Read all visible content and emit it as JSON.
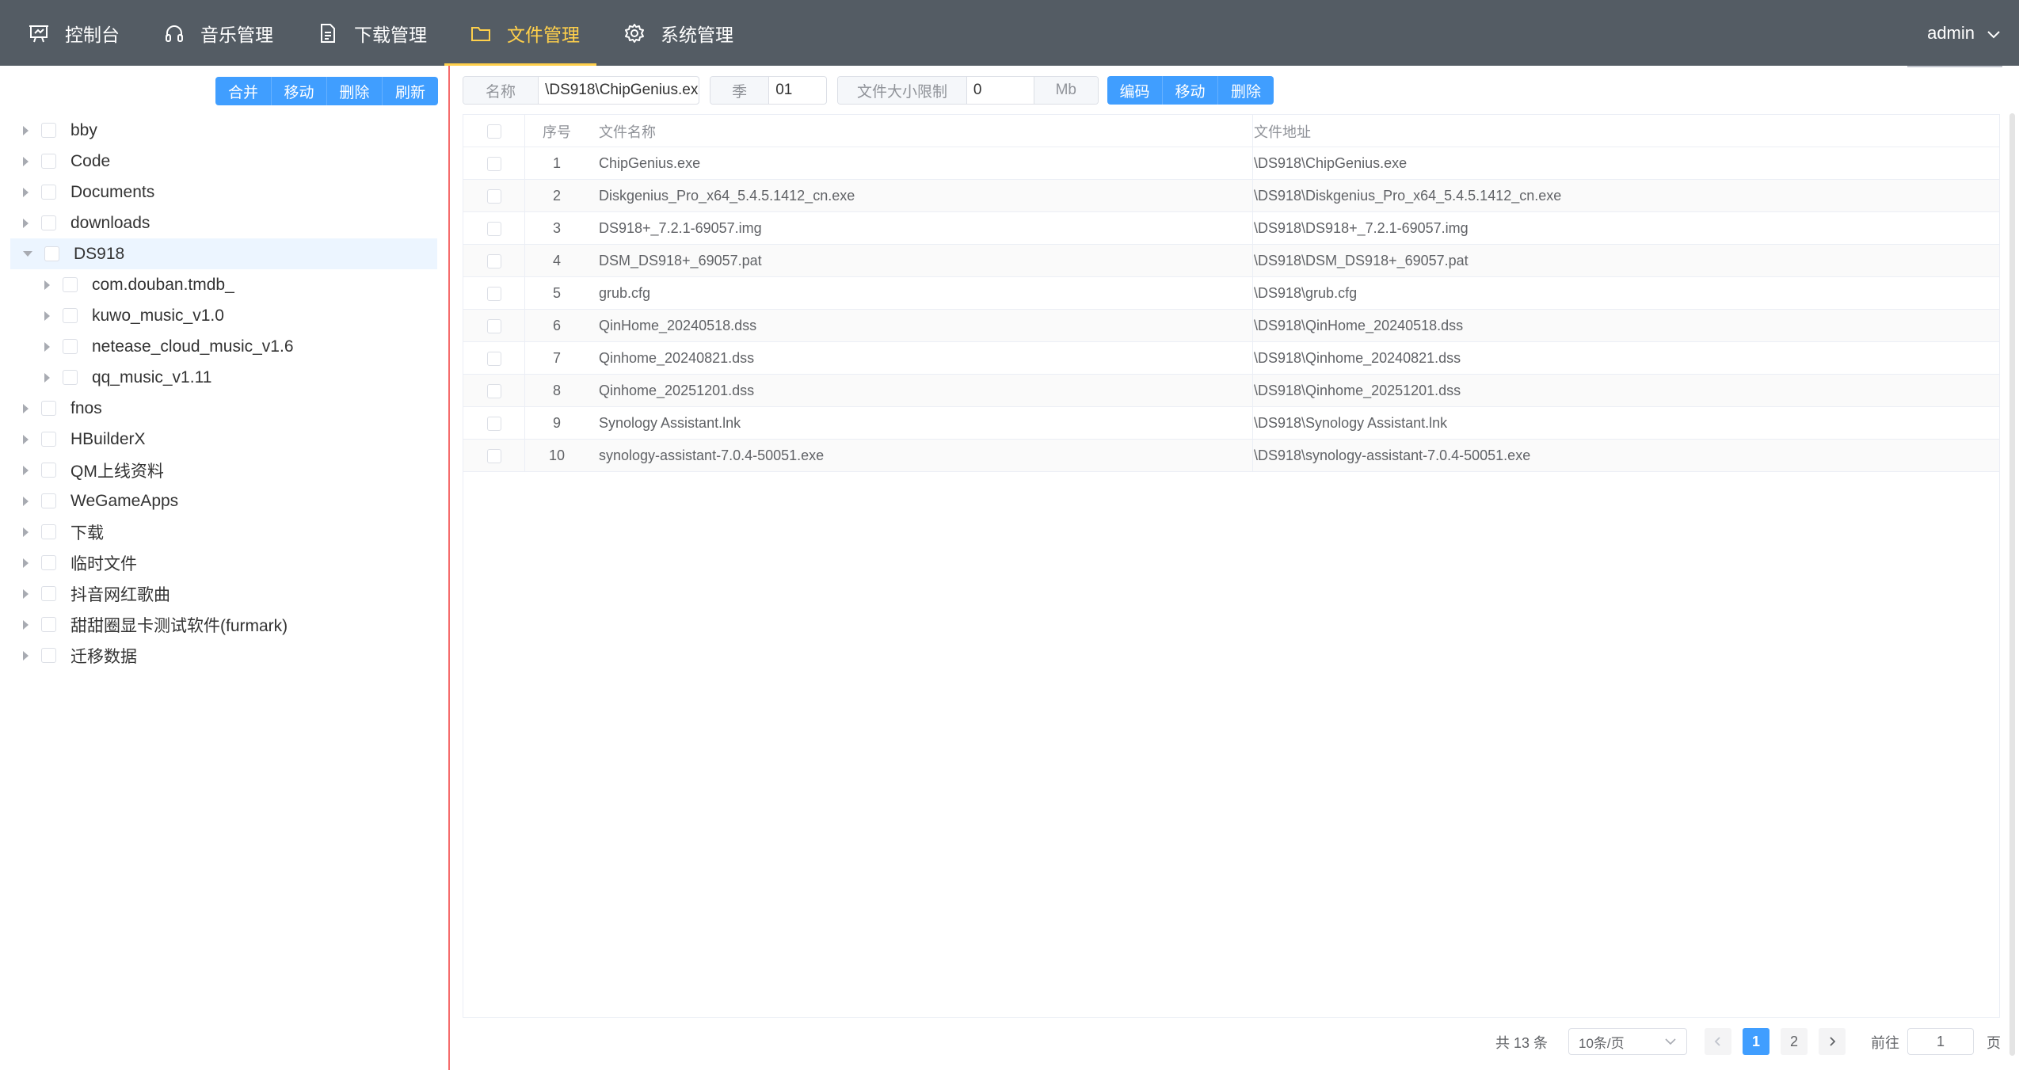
{
  "nav": {
    "items": [
      {
        "label": "控制台",
        "icon": "dashboard-icon"
      },
      {
        "label": "音乐管理",
        "icon": "headphones-icon"
      },
      {
        "label": "下载管理",
        "icon": "document-icon"
      },
      {
        "label": "文件管理",
        "icon": "folder-icon",
        "active": true
      },
      {
        "label": "系统管理",
        "icon": "gear-icon"
      }
    ],
    "user": "admin"
  },
  "tree_actions": [
    "合并",
    "移动",
    "删除",
    "刷新"
  ],
  "tree": [
    {
      "label": "bby"
    },
    {
      "label": "Code"
    },
    {
      "label": "Documents"
    },
    {
      "label": "downloads"
    },
    {
      "label": "DS918",
      "expanded": true,
      "selected": true
    },
    {
      "label": "com.douban.tmdb_",
      "child": true
    },
    {
      "label": "kuwo_music_v1.0",
      "child": true
    },
    {
      "label": "netease_cloud_music_v1.6",
      "child": true
    },
    {
      "label": "qq_music_v1.11",
      "child": true
    },
    {
      "label": "fnos"
    },
    {
      "label": "HBuilderX"
    },
    {
      "label": "QM上线资料"
    },
    {
      "label": "WeGameApps"
    },
    {
      "label": "下载"
    },
    {
      "label": "临时文件"
    },
    {
      "label": "抖音网红歌曲"
    },
    {
      "label": "甜甜圈显卡测试软件(furmark)"
    },
    {
      "label": "迁移数据"
    }
  ],
  "filters": {
    "name_label": "名称",
    "name_value": "\\DS918\\ChipGenius.ex",
    "season_label": "季",
    "season_value": "01",
    "size_label": "文件大小限制",
    "size_value": "0",
    "size_unit": "Mb"
  },
  "file_actions": [
    "编码",
    "移动",
    "删除"
  ],
  "table": {
    "headers": {
      "index": "序号",
      "name": "文件名称",
      "path": "文件地址"
    },
    "rows": [
      {
        "index": "1",
        "name": "ChipGenius.exe",
        "path": "\\DS918\\ChipGenius.exe"
      },
      {
        "index": "2",
        "name": "Diskgenius_Pro_x64_5.4.5.1412_cn.exe",
        "path": "\\DS918\\Diskgenius_Pro_x64_5.4.5.1412_cn.exe"
      },
      {
        "index": "3",
        "name": "DS918+_7.2.1-69057.img",
        "path": "\\DS918\\DS918+_7.2.1-69057.img"
      },
      {
        "index": "4",
        "name": "DSM_DS918+_69057.pat",
        "path": "\\DS918\\DSM_DS918+_69057.pat"
      },
      {
        "index": "5",
        "name": "grub.cfg",
        "path": "\\DS918\\grub.cfg"
      },
      {
        "index": "6",
        "name": "QinHome_20240518.dss",
        "path": "\\DS918\\QinHome_20240518.dss"
      },
      {
        "index": "7",
        "name": "Qinhome_20240821.dss",
        "path": "\\DS918\\Qinhome_20240821.dss"
      },
      {
        "index": "8",
        "name": "Qinhome_20251201.dss",
        "path": "\\DS918\\Qinhome_20251201.dss"
      },
      {
        "index": "9",
        "name": "Synology Assistant.lnk",
        "path": "\\DS918\\Synology Assistant.lnk"
      },
      {
        "index": "10",
        "name": "synology-assistant-7.0.4-50051.exe",
        "path": "\\DS918\\synology-assistant-7.0.4-50051.exe"
      }
    ]
  },
  "pagination": {
    "total": "共 13 条",
    "page_size": "10条/页",
    "pages": [
      "1",
      "2"
    ],
    "current": "1",
    "goto_label": "前往",
    "goto_value": "1",
    "goto_suffix": "页"
  },
  "colors": {
    "nav_bg": "#545c64",
    "nav_active": "#ffd04b",
    "primary": "#409eff",
    "splitter": "#f56c6c"
  }
}
